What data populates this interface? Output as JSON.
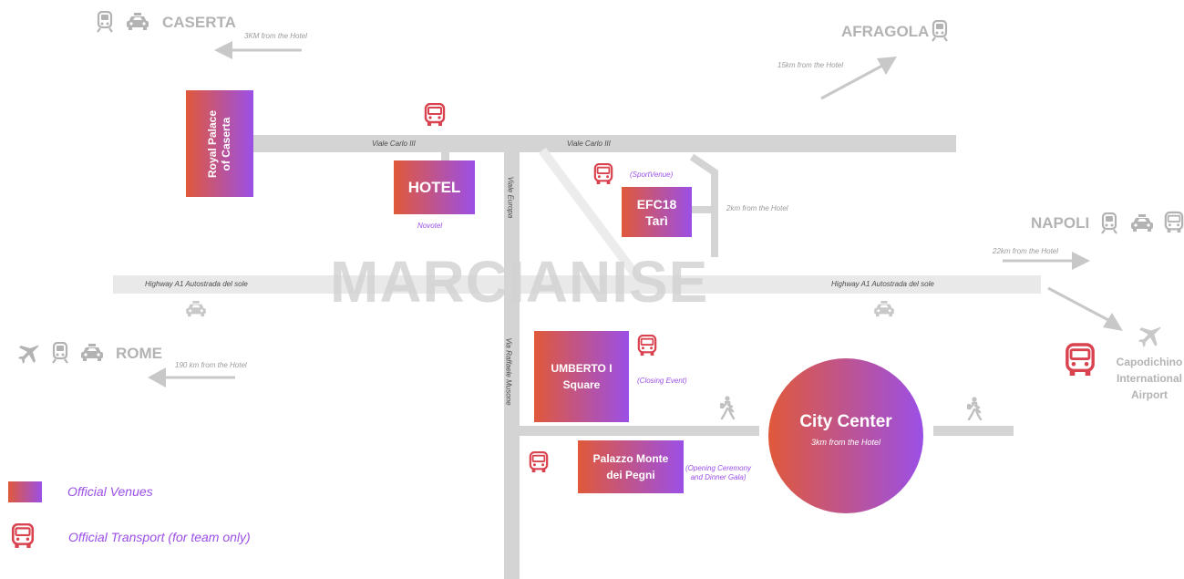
{
  "town": "MARCIANISE",
  "roads": {
    "viale_carlo_left": "Viale Carlo III",
    "viale_carlo_right": "Viale Carlo III",
    "viale_europa": "Viale Europa",
    "highway_left": "Highway A1 Autostrada del sole",
    "highway_right": "Highway A1 Autostrada del sole",
    "via_raffaele": "Via Raffaele Musone"
  },
  "cities": {
    "caserta": {
      "name": "CASERTA",
      "distance": "3KM from the Hotel"
    },
    "afragola": {
      "name": "AFRAGOLA",
      "distance": "15km from the Hotel"
    },
    "napoli": {
      "name": "NAPOLI",
      "distance": "22km from the Hotel"
    },
    "rome": {
      "name": "ROME",
      "distance": "190 km from the Hotel"
    },
    "airport": {
      "line1": "Capodichino",
      "line2": "International",
      "line3": "Airport"
    }
  },
  "venues": {
    "royal_palace": {
      "line1": "Royal Palace",
      "line2": "of Caserta"
    },
    "hotel": {
      "label": "HOTEL",
      "note": "Novotel"
    },
    "efc": {
      "line1": "EFC18",
      "line2": "Tarì",
      "note": "(SportVenue)",
      "distance": "2km from the Hotel"
    },
    "umberto": {
      "line1": "UMBERTO I",
      "line2": "Square",
      "note": "(Closing Event)"
    },
    "palazzo": {
      "line1": "Palazzo Monte",
      "line2": "dei Pegni",
      "note_line1": "(Opening Ceremony",
      "note_line2": "and Dinner Gala)"
    },
    "city_center": {
      "label": "City Center",
      "distance": "3km from the Hotel"
    }
  },
  "legend": {
    "venues": "Official Venues",
    "transport": "Official Transport (for team only)"
  },
  "colors": {
    "gradient_start": "#e0593a",
    "gradient_end": "#9b4fe6",
    "road": "#d4d4d4",
    "highway": "#e9e9e9",
    "muted": "#b3b3b3"
  },
  "icons": [
    "train-icon",
    "taxi-icon",
    "bus-icon",
    "plane-icon",
    "walker-icon",
    "arrow-icon"
  ]
}
